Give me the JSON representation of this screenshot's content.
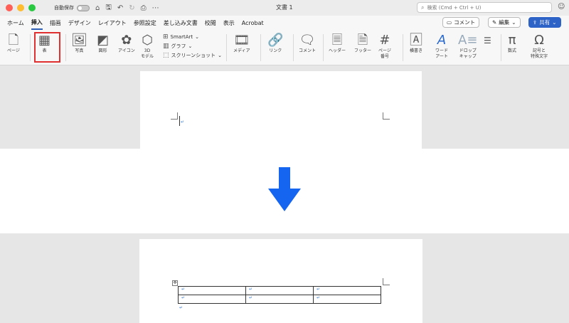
{
  "titlebar": {
    "traffic_colors": [
      "#ff5f57",
      "#febc2e",
      "#28c840"
    ],
    "autosave_label": "自動保存",
    "doc_title": "文書 1",
    "search_placeholder": "検索 (Cmd + Ctrl + U)",
    "icons": [
      "home-icon",
      "save-icon",
      "undo-icon",
      "redo-icon",
      "print-icon",
      "more-icon",
      "people-icon"
    ]
  },
  "tabs": {
    "items": [
      "ホーム",
      "挿入",
      "描画",
      "デザイン",
      "レイアウト",
      "参照設定",
      "差し込み文書",
      "校閲",
      "表示",
      "Acrobat"
    ],
    "active": "挿入",
    "comment_label": "コメント",
    "edit_label": "編集",
    "share_label": "共有"
  },
  "ribbon": {
    "page": "ページ",
    "table": "表",
    "photo": "写真",
    "shapes": "図形",
    "icons": "アイコン",
    "model3d_1": "3D",
    "model3d_2": "モデル",
    "smartart": "SmartArt",
    "chart": "グラフ",
    "screenshot": "スクリーンショット",
    "media": "メディア",
    "link": "リンク",
    "comment": "コメント",
    "header": "ヘッダー",
    "footer": "フッター",
    "page_number_1": "ページ",
    "page_number_2": "番号",
    "textbox": "横書き",
    "wordart_1": "ワード",
    "wordart_2": "アート",
    "dropcap_1": "ドロップ",
    "dropcap_2": "キャップ",
    "equation": "数式",
    "symbol_1": "記号と",
    "symbol_2": "特殊文字"
  },
  "document": {
    "paragraph_mark": "↵",
    "arrow_color": "#1565f0",
    "table_rows": [
      [
        "↵",
        "↵",
        "↵"
      ],
      [
        "↵",
        "↵",
        "↵"
      ]
    ],
    "after_table_mark": "↵"
  }
}
